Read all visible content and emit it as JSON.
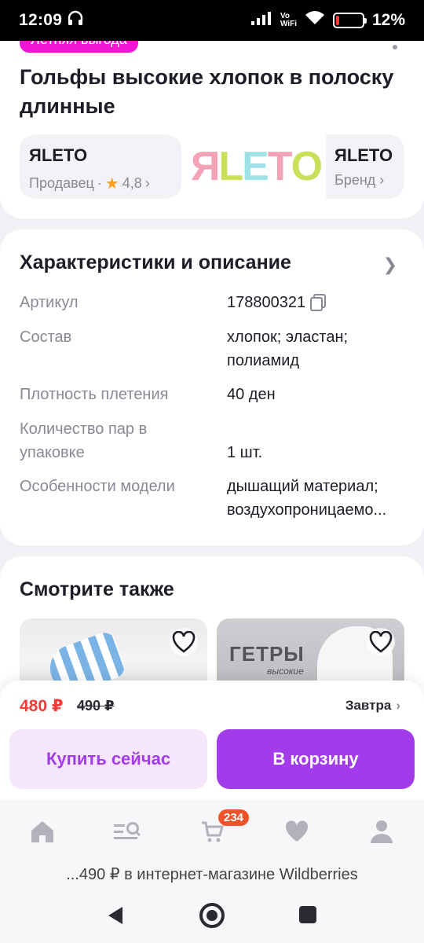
{
  "status_bar": {
    "time": "12:09",
    "vowifi_line1": "Vo",
    "vowifi_line2": "WiFi",
    "battery": "12%",
    "battery_level": 0.12
  },
  "product": {
    "promo_badge": "Летняя выгода",
    "title": "Гольфы высокие хлопок в полоску длинные"
  },
  "seller": {
    "name": "ЯLETO",
    "label": "Продавец",
    "rating": "4,8"
  },
  "brand": {
    "logo_text": "ЯLETO",
    "name": "ЯLETO",
    "label": "Бренд"
  },
  "specs": {
    "title": "Характеристики и описание",
    "rows": [
      {
        "label": "Артикул",
        "value": "178800321"
      },
      {
        "label": "Состав",
        "value": "хлопок; эластан; полиамид"
      },
      {
        "label": "Плотность плетения",
        "value": "40 ден"
      },
      {
        "label": "Количество пар в упаковке",
        "value": "1 шт."
      },
      {
        "label": "Особенности модели",
        "value": "дышащий материал; воздухопроницаемо..."
      }
    ]
  },
  "see_also": {
    "title": "Смотрите также",
    "items": [
      {
        "caption": ""
      },
      {
        "caption": "ГЕТРЫ",
        "subcaption": "высокие"
      }
    ]
  },
  "price_sheet": {
    "price": "480 ₽",
    "old_price": "490 ₽",
    "delivery": "Завтра",
    "buy_now": "Купить сейчас",
    "add_to_cart": "В корзину"
  },
  "nav": {
    "cart_badge": "234"
  },
  "page_footer": "...490 ₽ в интернет-магазине Wildberries",
  "colors": {
    "accent": "#a43bea",
    "price": "#f23b3b",
    "promo": "#f215d6",
    "badge": "#f0532b"
  }
}
